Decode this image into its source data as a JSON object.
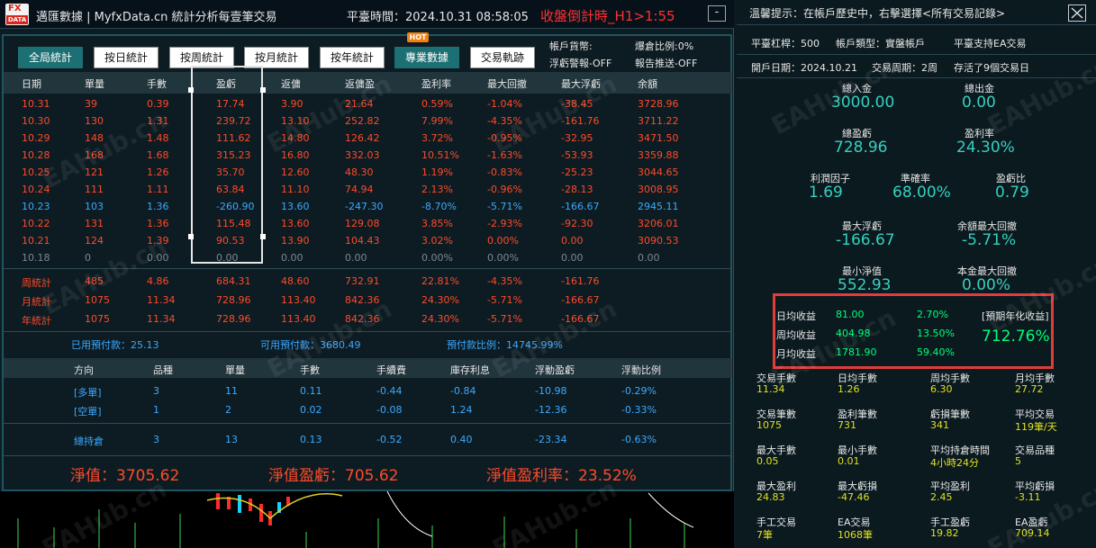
{
  "titlebar": {
    "title": "邁匯數據 | MyfxData.cn  統計分析每壹筆交易",
    "platform_time": "平臺時間：2024.10.31 08:58:05",
    "countdown": "收盤倒計時_H1>1:55",
    "minimize": "-"
  },
  "logo": {
    "top": "FX",
    "bottom": "DATA"
  },
  "nav": {
    "tabs": [
      "全局統計",
      "按日統計",
      "按周統計",
      "按月統計",
      "按年統計",
      "專業數據",
      "交易軌跡"
    ],
    "hot_badge": "HOT"
  },
  "account_flags": {
    "currency": "帳戶貨幣:",
    "lockratio": "爆倉比例:0%",
    "float_alert": "浮虧警報-OFF",
    "report_push": "報告推送-OFF"
  },
  "table": {
    "headers": [
      "日期",
      "單量",
      "手數",
      "盈虧",
      "返傭",
      "返傭盈",
      "盈利率",
      "最大回撤",
      "最大浮虧",
      "余額"
    ],
    "rows": [
      [
        "10.31",
        "39",
        "0.39",
        "17.74",
        "3.90",
        "21.64",
        "0.59%",
        "-1.04%",
        "-38.45",
        "3728.96"
      ],
      [
        "10.30",
        "130",
        "1.31",
        "239.72",
        "13.10",
        "252.82",
        "7.99%",
        "-4.35%",
        "-161.76",
        "3711.22"
      ],
      [
        "10.29",
        "148",
        "1.48",
        "111.62",
        "14.80",
        "126.42",
        "3.72%",
        "-0.95%",
        "-32.95",
        "3471.50"
      ],
      [
        "10.28",
        "168",
        "1.68",
        "315.23",
        "16.80",
        "332.03",
        "10.51%",
        "-1.63%",
        "-53.93",
        "3359.88"
      ],
      [
        "10.25",
        "121",
        "1.26",
        "35.70",
        "12.60",
        "48.30",
        "1.19%",
        "-0.83%",
        "-25.23",
        "3044.65"
      ],
      [
        "10.24",
        "111",
        "1.11",
        "63.84",
        "11.10",
        "74.94",
        "2.13%",
        "-0.96%",
        "-28.13",
        "3008.95"
      ],
      [
        "10.23",
        "103",
        "1.36",
        "-260.90",
        "13.60",
        "-247.30",
        "-8.70%",
        "-5.71%",
        "-166.67",
        "2945.11"
      ],
      [
        "10.22",
        "131",
        "1.36",
        "115.48",
        "13.60",
        "129.08",
        "3.85%",
        "-2.93%",
        "-92.30",
        "3206.01"
      ],
      [
        "10.21",
        "124",
        "1.39",
        "90.53",
        "13.90",
        "104.43",
        "3.02%",
        "0.00%",
        "0.00",
        "3090.53"
      ],
      [
        "10.18",
        "0",
        "0.00",
        "0.00",
        "0.00",
        "0.00",
        "0.00%",
        "0.00%",
        "0.00",
        "0.00"
      ]
    ],
    "row_colors": [
      "red",
      "red",
      "red",
      "red",
      "red",
      "red",
      "blue",
      "red",
      "red",
      "gray"
    ],
    "summary": [
      [
        "周統計",
        "485",
        "4.86",
        "684.31",
        "48.60",
        "732.91",
        "22.81%",
        "-4.35%",
        "-161.76"
      ],
      [
        "月統計",
        "1075",
        "11.34",
        "728.96",
        "113.40",
        "842.36",
        "24.30%",
        "-5.71%",
        "-166.67"
      ],
      [
        "年統計",
        "1075",
        "11.34",
        "728.96",
        "113.40",
        "842.36",
        "24.30%",
        "-5.71%",
        "-166.67"
      ]
    ]
  },
  "margin": {
    "used": "已用預付款：25.13",
    "free": "可用預付款：3680.49",
    "ratio": "預付款比例：14745.99%"
  },
  "positions": {
    "headers": [
      "方向",
      "品種",
      "單量",
      "手數",
      "手續費",
      "庫存利息",
      "浮動盈虧",
      "浮動比例"
    ],
    "rows": [
      [
        "[多單]",
        "3",
        "11",
        "0.11",
        "-0.44",
        "-0.84",
        "-10.98",
        "-0.29%"
      ],
      [
        "[空單]",
        "1",
        "2",
        "0.02",
        "-0.08",
        "1.24",
        "-12.36",
        "-0.33%"
      ]
    ],
    "total": [
      "總持倉",
      "3",
      "13",
      "0.13",
      "-0.52",
      "0.40",
      "-23.34",
      "-0.63%"
    ]
  },
  "equity": {
    "net": "淨值：3705.62",
    "pnl": "淨值盈虧：705.62",
    "rate": "淨值盈利率：23.52%"
  },
  "right": {
    "tip": "溫馨提示：在帳戶歷史中，右擊選擇<所有交易記錄>",
    "leverage": "平臺杠桿：500",
    "acct_type": "帳戶類型：實盤帳戶",
    "ea_support": "平臺支持EA交易",
    "open_date": "開戶日期：2024.10.21",
    "trade_period": "交易周期：2周",
    "alive": "存活了9個交易日",
    "deposit_label": "總入金",
    "deposit": "3000.00",
    "withdraw_label": "總出金",
    "withdraw": "0.00",
    "total_pnl_label": "總盈虧",
    "total_pnl": "728.96",
    "profit_rate_label": "盈利率",
    "profit_rate": "24.30%",
    "pf_label": "利潤因子",
    "pf": "1.69",
    "accuracy_label": "準確率",
    "accuracy": "68.00%",
    "plratio_label": "盈虧比",
    "plratio": "0.79",
    "max_float_label": "最大浮虧",
    "max_float": "-166.67",
    "bal_dd_label": "余額最大回撤",
    "bal_dd": "-5.71%",
    "min_eq_label": "最小淨值",
    "min_eq": "552.93",
    "cap_dd_label": "本金最大回撤",
    "cap_dd": "0.00%",
    "daily_label": "日均收益",
    "daily_val": "81.00",
    "daily_pct": "2.70%",
    "weekly_label": "周均收益",
    "weekly_val": "404.98",
    "weekly_pct": "13.50%",
    "monthly_label": "月均收益",
    "monthly_val": "1781.90",
    "monthly_pct": "59.40%",
    "annual_label": "[預期年化收益]",
    "annual_val": "712.76%",
    "stats": [
      [
        "交易手數",
        "11.34"
      ],
      [
        "日均手數",
        "1.26"
      ],
      [
        "周均手數",
        "6.30"
      ],
      [
        "月均手數",
        "27.72"
      ],
      [
        "交易筆數",
        "1075"
      ],
      [
        "盈利筆數",
        "731"
      ],
      [
        "虧損筆數",
        "341"
      ],
      [
        "平均交易",
        "119筆/天"
      ],
      [
        "最大手數",
        "0.05"
      ],
      [
        "最小手數",
        "0.01"
      ],
      [
        "平均持倉時間",
        "4小時24分"
      ],
      [
        "交易品種",
        "5"
      ],
      [
        "最大盈利",
        "24.83"
      ],
      [
        "最大虧損",
        "-47.46"
      ],
      [
        "平均盈利",
        "2.45"
      ],
      [
        "平均虧損",
        "-3.11"
      ],
      [
        "手工交易",
        "7筆"
      ],
      [
        "EA交易",
        "1068筆"
      ],
      [
        "手工盈虧",
        "19.82"
      ],
      [
        "EA盈虧",
        "709.14"
      ]
    ]
  },
  "watermark": "EAHub.cn",
  "colors": {
    "red": "#ff4a2a",
    "blue": "#3ca8ff",
    "green": "#00ff7a",
    "cyan": "#35d0c0",
    "accent": "#1c6f72"
  }
}
